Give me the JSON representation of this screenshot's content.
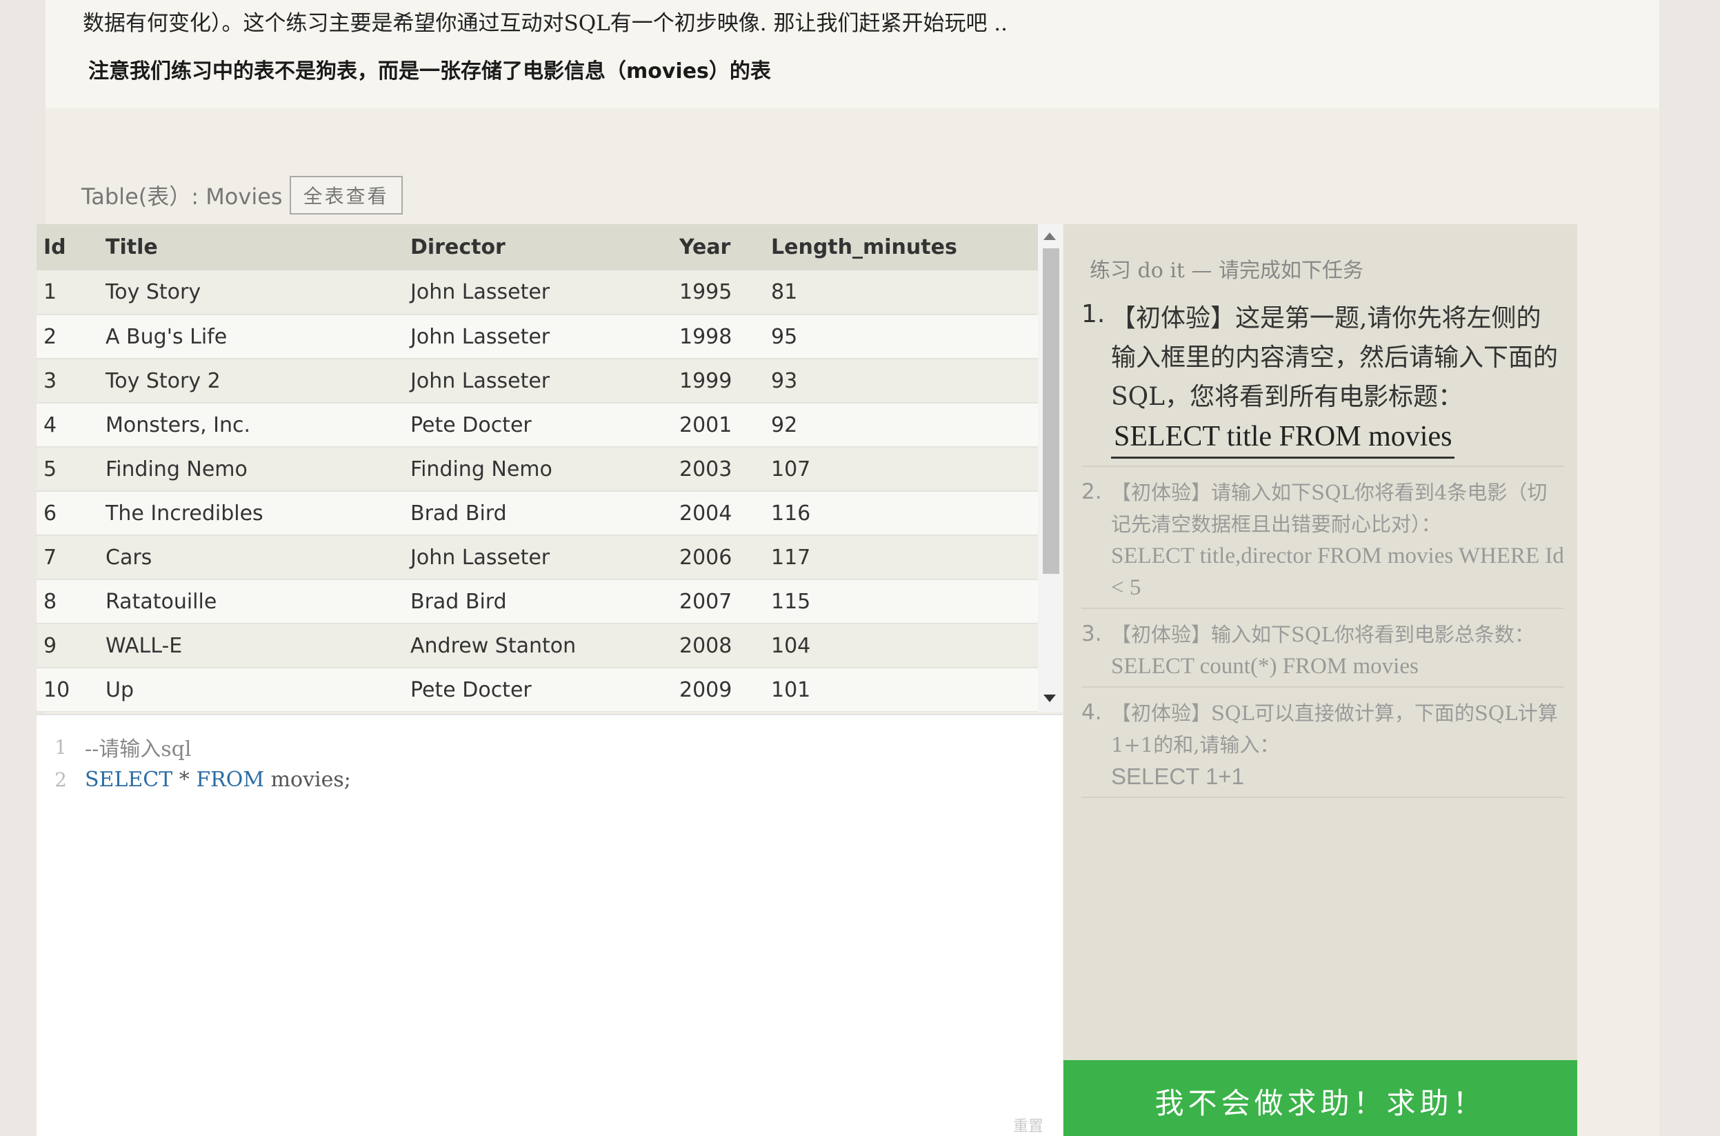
{
  "intro": {
    "line1": "数据有何变化）。这个练习主要是希望你通过互动对SQL有一个初步映像. 那让我们赶紧开始玩吧 ..",
    "line2_pre": "注意我们练习中的表不是狗表，而是一张存储了电影信息（",
    "line2_bold": "movies",
    "line2_post": "）的表"
  },
  "table": {
    "caption": "Table(表）: Movies",
    "view_all_label": "全表查看",
    "columns": [
      "Id",
      "Title",
      "Director",
      "Year",
      "Length_minutes"
    ],
    "rows": [
      [
        "1",
        "Toy Story",
        "John Lasseter",
        "1995",
        "81"
      ],
      [
        "2",
        "A Bug's Life",
        "John Lasseter",
        "1998",
        "95"
      ],
      [
        "3",
        "Toy Story 2",
        "John Lasseter",
        "1999",
        "93"
      ],
      [
        "4",
        "Monsters, Inc.",
        "Pete Docter",
        "2001",
        "92"
      ],
      [
        "5",
        "Finding Nemo",
        "Finding Nemo",
        "2003",
        "107"
      ],
      [
        "6",
        "The Incredibles",
        "Brad Bird",
        "2004",
        "116"
      ],
      [
        "7",
        "Cars",
        "John Lasseter",
        "2006",
        "117"
      ],
      [
        "8",
        "Ratatouille",
        "Brad Bird",
        "2007",
        "115"
      ],
      [
        "9",
        "WALL-E",
        "Andrew Stanton",
        "2008",
        "104"
      ],
      [
        "10",
        "Up",
        "Pete Docter",
        "2009",
        "101"
      ]
    ]
  },
  "editor": {
    "line1_no": "1",
    "line1_comment": "--请输入sql",
    "line2_no": "2",
    "line2_kw1": "SELECT",
    "line2_star": " * ",
    "line2_kw2": "FROM",
    "line2_rest": " movies;",
    "reset_label": "重置"
  },
  "tasks": {
    "header": "练习 do it — 请完成如下任务",
    "items": [
      {
        "num": "1.",
        "text": "【初体验】这是第一题,请你先将左侧的输入框里的内容清空，然后请输入下面的SQL，您将看到所有电影标题：",
        "sql": "SELECT title FROM movies"
      },
      {
        "num": "2.",
        "text": "【初体验】请输入如下SQL你将看到4条电影（切记先清空数据框且出错要耐心比对）：",
        "sql": "SELECT title,director FROM movies WHERE Id < 5"
      },
      {
        "num": "3.",
        "text": "【初体验】输入如下SQL你将看到电影总条数：",
        "sql": "SELECT count(*) FROM movies"
      },
      {
        "num": "4.",
        "text": "【初体验】SQL可以直接做计算，下面的SQL计算1+1的和,请输入：",
        "sql": "SELECT 1+1"
      }
    ]
  },
  "help_button_label": "我不会做求助！求助！"
}
